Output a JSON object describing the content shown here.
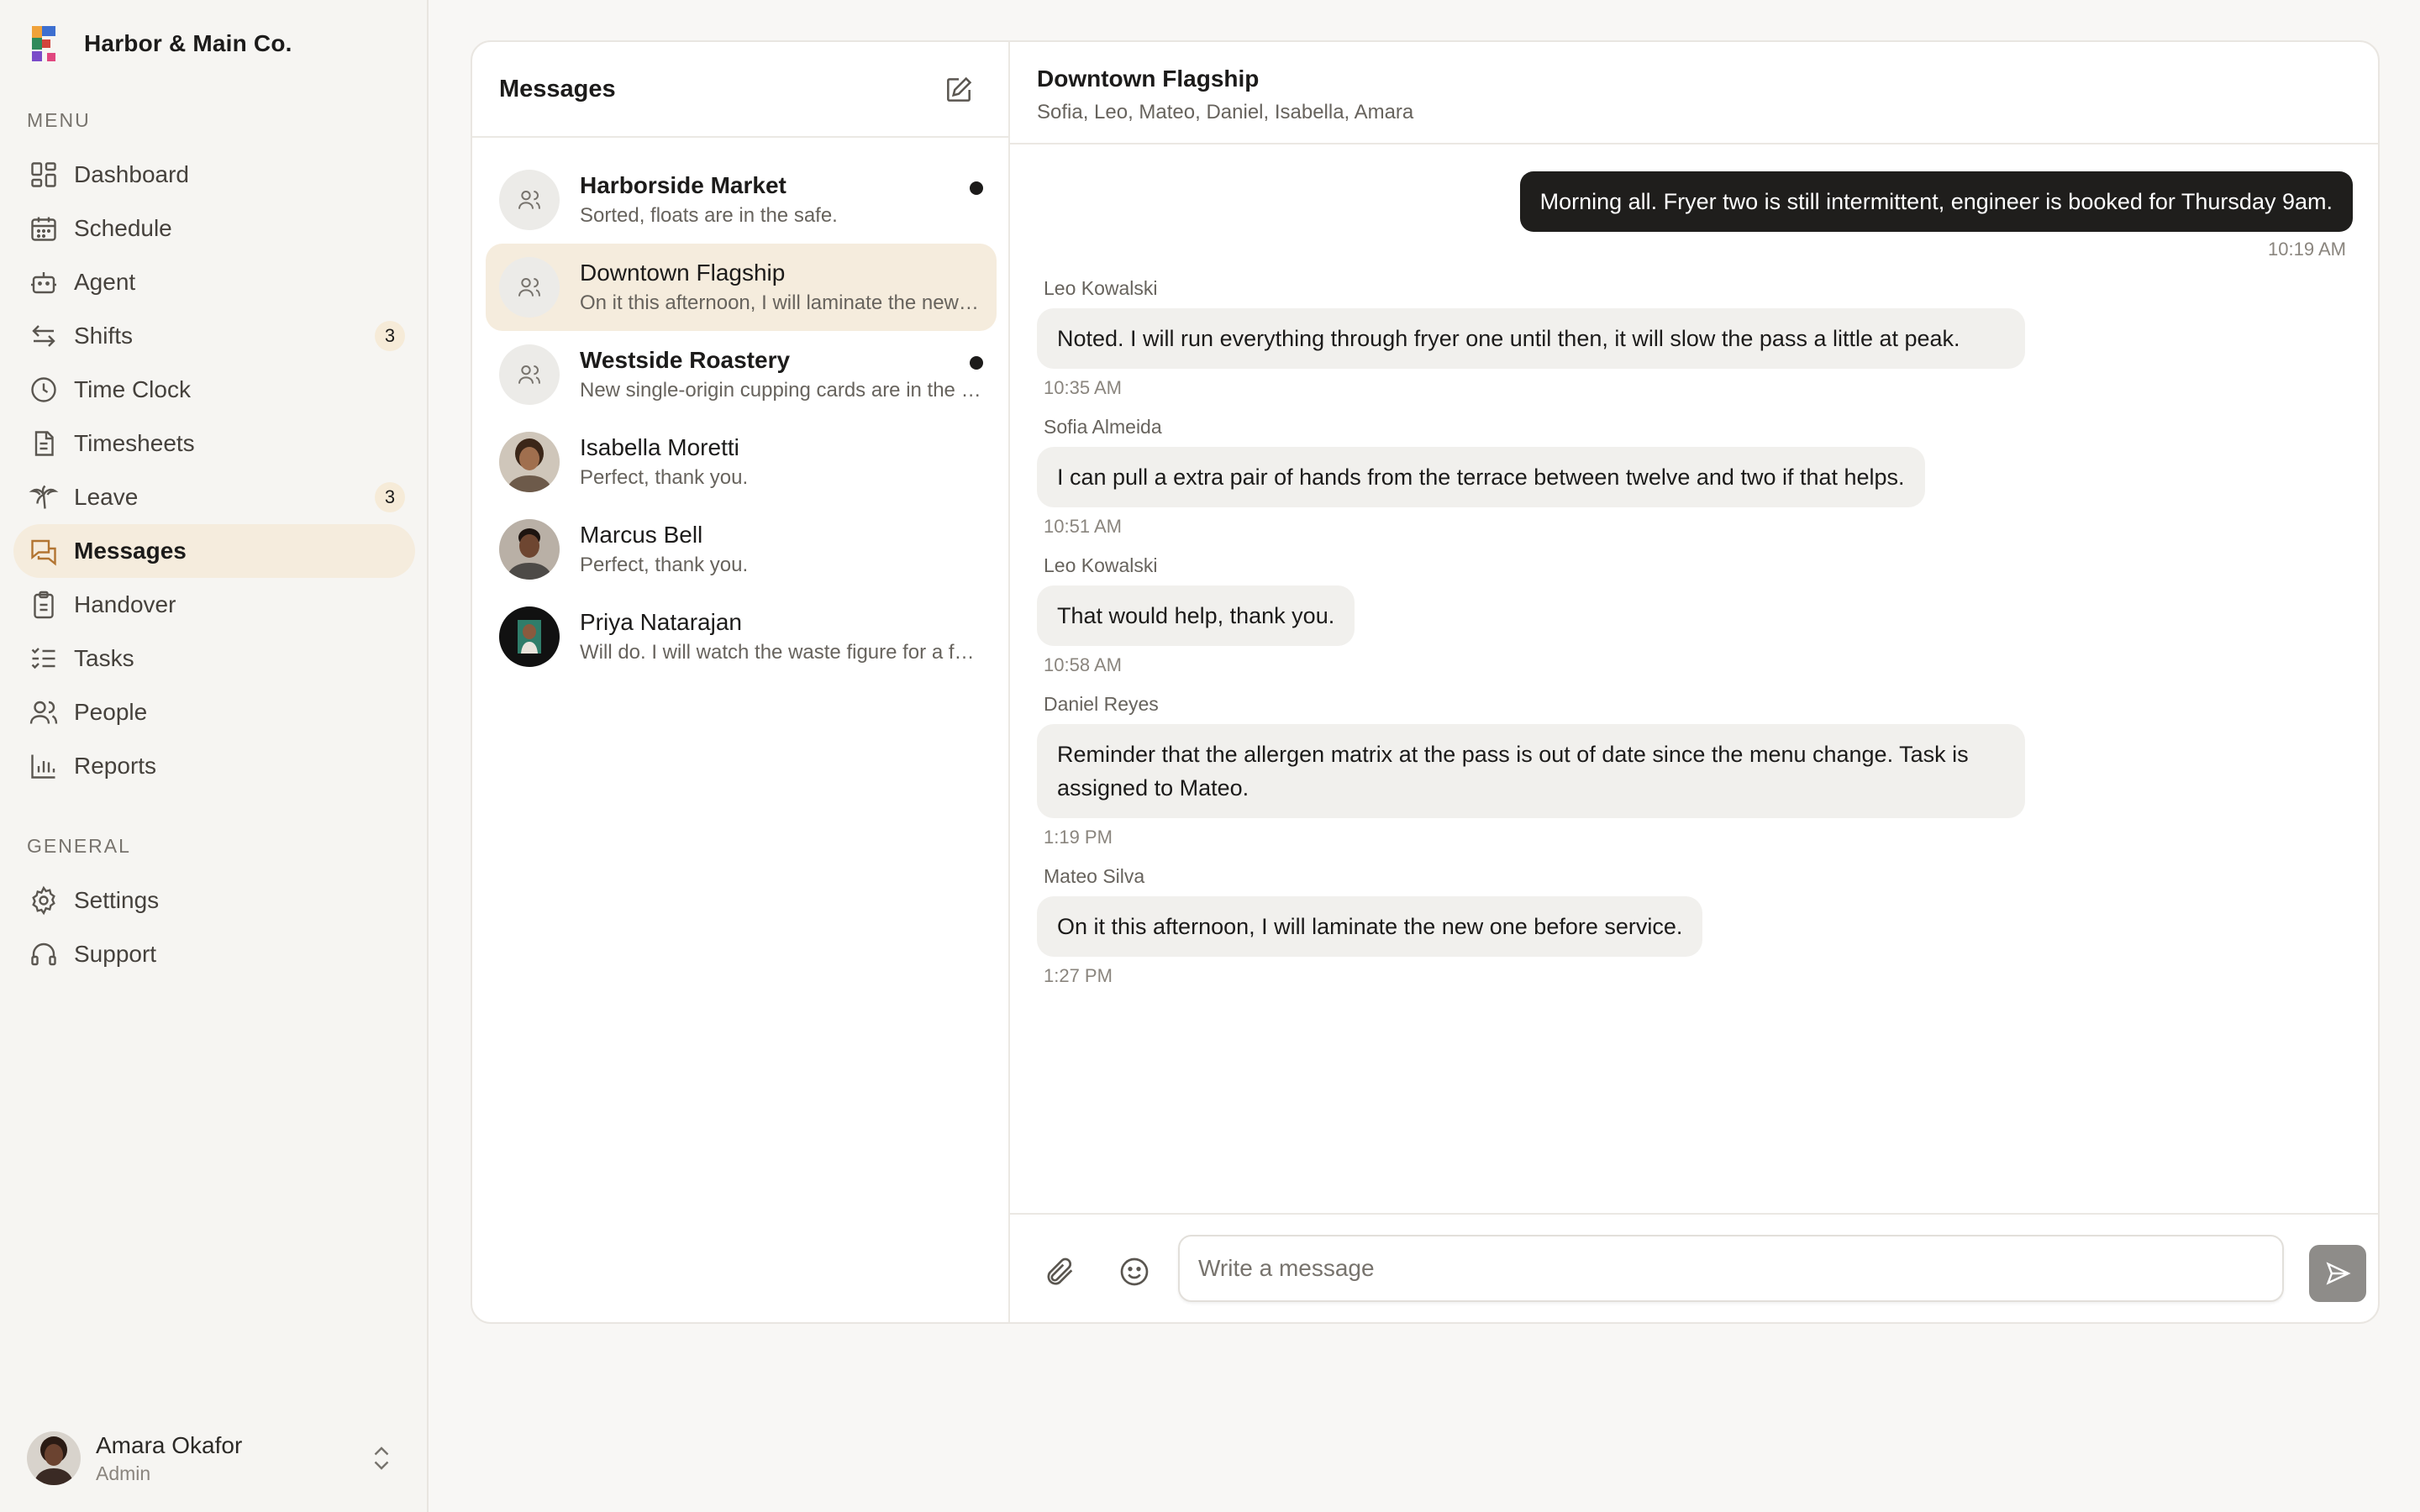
{
  "brand": {
    "name": "Harbor & Main Co."
  },
  "sidebar": {
    "menu_label": "MENU",
    "general_label": "GENERAL",
    "menu_items": [
      {
        "label": "Dashboard",
        "icon": "dashboard-icon"
      },
      {
        "label": "Schedule",
        "icon": "calendar-icon"
      },
      {
        "label": "Agent",
        "icon": "bot-icon"
      },
      {
        "label": "Shifts",
        "icon": "swap-icon",
        "badge": "3"
      },
      {
        "label": "Time Clock",
        "icon": "clock-icon"
      },
      {
        "label": "Timesheets",
        "icon": "document-icon"
      },
      {
        "label": "Leave",
        "icon": "palm-tree-icon",
        "badge": "3"
      },
      {
        "label": "Messages",
        "icon": "chat-icon",
        "active": true
      },
      {
        "label": "Handover",
        "icon": "clipboard-icon"
      },
      {
        "label": "Tasks",
        "icon": "list-check-icon"
      },
      {
        "label": "People",
        "icon": "users-icon"
      },
      {
        "label": "Reports",
        "icon": "bar-chart-icon"
      }
    ],
    "general_items": [
      {
        "label": "Settings",
        "icon": "gear-icon"
      },
      {
        "label": "Support",
        "icon": "headset-icon"
      }
    ],
    "user": {
      "name": "Amara Okafor",
      "role": "Admin"
    }
  },
  "messages": {
    "title": "Messages",
    "conversations": [
      {
        "name": "Harborside Market",
        "preview": "Sorted, floats are in the safe.",
        "unread": true,
        "group": true
      },
      {
        "name": "Downtown Flagship",
        "preview": "On it this afternoon, I will laminate the new one before service.",
        "unread": false,
        "group": true,
        "active": true
      },
      {
        "name": "Westside Roastery",
        "preview": "New single-origin cupping cards are in the back office.",
        "unread": true,
        "group": true
      },
      {
        "name": "Isabella Moretti",
        "preview": "Perfect, thank you.",
        "unread": false,
        "group": false
      },
      {
        "name": "Marcus Bell",
        "preview": "Perfect, thank you.",
        "unread": false,
        "group": false
      },
      {
        "name": "Priya Natarajan",
        "preview": "Will do. I will watch the waste figure for a few days.",
        "unread": false,
        "group": false
      }
    ]
  },
  "chat": {
    "title": "Downtown Flagship",
    "members": "Sofia, Leo, Mateo, Daniel, Isabella, Amara",
    "outgoing": {
      "text": "Morning all. Fryer two is still intermittent, engineer is booked for Thursday 9am.",
      "time": "10:19 AM"
    },
    "incoming": [
      {
        "sender": "Leo Kowalski",
        "text": "Noted. I will run everything through fryer one until then, it will slow the pass a little at peak.",
        "time": "10:35 AM"
      },
      {
        "sender": "Sofia Almeida",
        "text": "I can pull a extra pair of hands from the terrace between twelve and two if that helps.",
        "time": "10:51 AM"
      },
      {
        "sender": "Leo Kowalski",
        "text": "That would help, thank you.",
        "time": "10:58 AM"
      },
      {
        "sender": "Daniel Reyes",
        "text": "Reminder that the allergen matrix at the pass is out of date since the menu change. Task is assigned to Mateo.",
        "time": "1:19 PM"
      },
      {
        "sender": "Mateo Silva",
        "text": "On it this afternoon, I will laminate the new one before service.",
        "time": "1:27 PM"
      }
    ],
    "composer": {
      "placeholder": "Write a message",
      "value": ""
    }
  },
  "colors": {
    "accent_bg": "#f5ecdd",
    "outgoing_bubble": "#1f1e1c",
    "incoming_bubble": "#f1f0ed",
    "send_button": "#8e8c89"
  }
}
